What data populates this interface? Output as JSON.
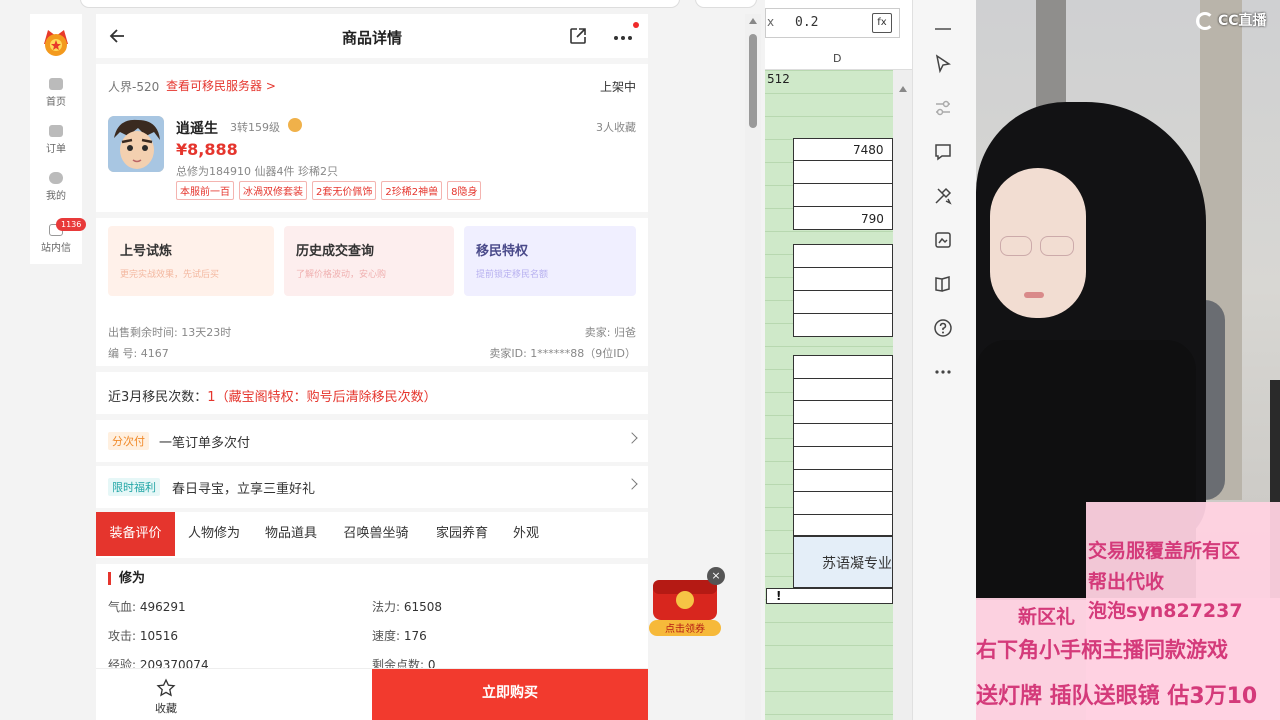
{
  "page": {
    "title": "商品详情"
  },
  "sidebar": {
    "items": [
      {
        "label": "首页",
        "icon": "home-icon"
      },
      {
        "label": "订单",
        "icon": "order-icon"
      },
      {
        "label": "我的",
        "icon": "user-icon"
      },
      {
        "label": "站内信",
        "icon": "mail-icon",
        "badge": "1136"
      }
    ]
  },
  "product": {
    "server": "人界-520",
    "server_link": "查看可移民服务器 >",
    "status": "上架中",
    "name": "逍遥生",
    "level": "3转159级",
    "favorites": "3人收藏",
    "price": "¥8,888",
    "stats": "总修为184910  仙器4件  珍稀2只",
    "tags": [
      "本服前一百",
      "冰渦双修套装",
      "2套无价佩饰",
      "2珍稀2神兽",
      "8隐身"
    ]
  },
  "actions": [
    {
      "title": "上号试炼",
      "sub": "更完实战效果，先试后买"
    },
    {
      "title": "历史成交查询",
      "sub": "了解价格波动，安心购"
    },
    {
      "title": "移民特权",
      "sub": "提前锁定移民名额"
    }
  ],
  "meta": {
    "remaining": "出售剩余时间: 13天23时",
    "seller": "卖家: 归爸",
    "number": "编 号: 4167",
    "seller_id": "卖家ID: 1******88（9位ID）"
  },
  "migration": {
    "label": "近3月移民次数：",
    "count": "1",
    "note": "（藏宝阁特权：购号后清除移民次数）"
  },
  "pay_row": {
    "badge": "分次付",
    "text": "一笔订单多次付"
  },
  "limited_row": {
    "badge": "限时福利",
    "text": "春日寻宝，立享三重好礼"
  },
  "tabs": [
    "装备评价",
    "人物修为",
    "物品道具",
    "召唤兽坐骑",
    "家园养育",
    "外观"
  ],
  "attributes": {
    "heading": "修为",
    "items": [
      {
        "label": "气血: ",
        "value": "496291"
      },
      {
        "label": "法力: ",
        "value": "61508"
      },
      {
        "label": "攻击: ",
        "value": "10516"
      },
      {
        "label": "速度: ",
        "value": "176"
      },
      {
        "label": "经验: ",
        "value": "209370074"
      },
      {
        "label": "剩余点数: ",
        "value": "0"
      }
    ]
  },
  "footer": {
    "fav_label": "收藏",
    "buy_label": "立即购买"
  },
  "coupon": {
    "label": "点击领券"
  },
  "sheet": {
    "fx_label": "x",
    "formula_value": "0.2",
    "fx_button": "fx",
    "column": "D",
    "cell_512": "512",
    "cell_7480": "7480",
    "cell_790": "790",
    "banner": "苏语凝专业",
    "mark": "!"
  },
  "stream": {
    "watermark": "CC直播",
    "lines": [
      "交易服覆盖所有区",
      "帮出代收",
      "新区礼",
      "泡泡syn827237",
      "右下角小手柄主播同款游戏",
      "送灯牌 插队送眼镜 估3万10"
    ]
  }
}
